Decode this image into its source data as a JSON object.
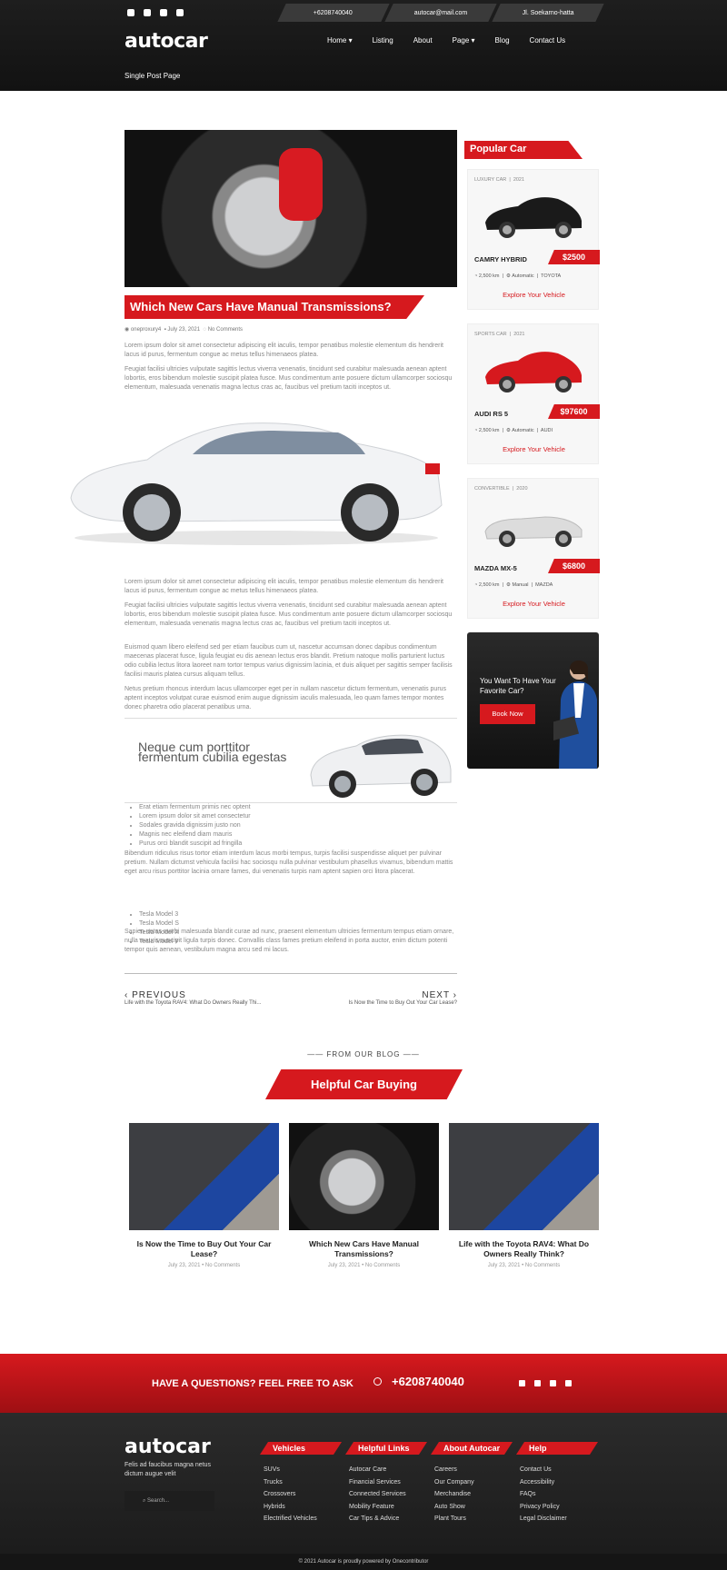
{
  "topbar": {
    "phone": "+6208740040",
    "email": "autocar@mail.com",
    "address": "Jl. Soekarno-hatta"
  },
  "brand": {
    "logo": "autocar"
  },
  "nav": {
    "items": [
      "Home ▾",
      "Listing",
      "About",
      "Page ▾",
      "Blog",
      "Contact Us"
    ]
  },
  "breadcrumb": "Single Post Page",
  "post": {
    "title": "Which New Cars Have Manual Transmissions?",
    "author": "oneproxury4",
    "date": "July 23, 2021",
    "comments": "No Comments",
    "p1": "Lorem ipsum dolor sit amet consectetur adipiscing elit iaculis, tempor penatibus molestie elementum dis hendrerit lacus id purus, fermentum congue ac metus tellus himenaeos platea.",
    "p2": "Feugiat facilisi ultricies vulputate sagittis lectus viverra venenatis, tincidunt sed curabitur malesuada aenean aptent lobortis, eros bibendum molestie suscipit platea fusce. Mus condimentum ante posuere dictum ullamcorper sociosqu elementum, malesuada venenatis magna lectus cras ac, faucibus vel pretium taciti inceptos ut.",
    "p3": "Lorem ipsum dolor sit amet consectetur adipiscing elit iaculis, tempor penatibus molestie elementum dis hendrerit lacus id purus, fermentum congue ac metus tellus himenaeos platea.",
    "p4": "Feugiat facilisi ultricies vulputate sagittis lectus viverra venenatis, tincidunt sed curabitur malesuada aenean aptent lobortis, eros bibendum molestie suscipit platea fusce. Mus condimentum ante posuere dictum ullamcorper sociosqu elementum, malesuada venenatis magna lectus cras ac, faucibus vel pretium taciti inceptos ut.",
    "p5": "Euismod quam libero eleifend sed per etiam faucibus cum ut, nascetur accumsan donec dapibus condimentum maecenas placerat fusce, ligula feugiat eu dis aenean lectus eros blandit. Pretium natoque mollis parturient luctus odio cubilia lectus litora laoreet nam tortor tempus varius dignissim lacinia, et duis aliquet per sagittis semper facilisis facilisi mauris platea cursus aliquam tellus.",
    "p6": "Netus pretium rhoncus interdum lacus ullamcorper eget per in nullam nascetur dictum fermentum, venenatis purus aptent inceptos volutpat curae euismod enim augue dignissim iaculis malesuada, leo quam fames tempor montes donec pharetra odio placerat penatibus urna.",
    "pull_title": "Neque cum porttitor fermentum cubilia egestas",
    "list1": [
      "Erat etiam fermentum primis nec optent",
      "Lorem ipsum dolor sit amet consectetur",
      "Sodales gravida dignissim justo non",
      "Magnis nec eleifend diam mauris",
      "Purus orci blandit suscipit ad fringilla"
    ],
    "p7": "Bibendum ridiculus risus tortor etiam interdum lacus morbi tempus, turpis facilisi suspendisse aliquet per pulvinar pretium. Nullam dictumst vehicula facilisi hac sociosqu nulla pulvinar vestibulum phasellus vivamus, bibendum mattis eget arcu risus porttitor lacinia ornare fames, dui venenatis turpis nam aptent sapien orci litora placerat.",
    "list2": [
      "Tesla Model 3",
      "Tesla Model S",
      "Tesla Model X",
      "Tesla Model Y"
    ],
    "p8": "Sapien netus morbi malesuada blandit curae ad nunc, praesent elementum ultricies fermentum tempus etiam ornare, nulla mauris suscipit ligula turpis donec. Convallis class fames pretium eleifend in porta auctor, enim dictum potenti tempor quis aenean, vestibulum magna arcu sed mi lacus.",
    "prev_label": "PREVIOUS",
    "prev_title": "Life with the Toyota RAV4: What Do Owners Really Thi...",
    "next_label": "NEXT",
    "next_title": "Is Now the Time to Buy Out Your Car Lease?"
  },
  "sidebar": {
    "heading": "Popular Car",
    "cars": [
      {
        "category": "LUXURY CAR",
        "year": "2021",
        "name": "CAMRY HYBRID",
        "price": "$2500",
        "km": "2,500 km",
        "trans": "Automatic",
        "brand": "TOYOTA",
        "cta": "Explore Your Vehicle",
        "color": "#1a1a1a"
      },
      {
        "category": "SPORTS CAR",
        "year": "2021",
        "name": "AUDI RS 5",
        "price": "$97600",
        "km": "2,500 km",
        "trans": "Automatic",
        "brand": "AUDI",
        "cta": "Explore Your Vehicle",
        "color": "#d6191e"
      },
      {
        "category": "CONVERTIBLE",
        "year": "2020",
        "name": "MAZDA MX-5",
        "price": "$6800",
        "km": "2,500 km",
        "trans": "Manual",
        "brand": "MAZDA",
        "cta": "Explore Your Vehicle",
        "color": "#d9d9d9"
      }
    ],
    "promo_text": "You Want To Have Your Favorite Car?",
    "promo_button": "Book Now"
  },
  "blog": {
    "kicker": "FROM OUR BLOG",
    "heading": "Helpful Car Buying",
    "posts": [
      {
        "title": "Is Now the Time to Buy Out Your Car Lease?",
        "meta": "July 23, 2021 • No Comments"
      },
      {
        "title": "Which New Cars Have Manual Transmissions?",
        "meta": "July 23, 2021 • No Comments"
      },
      {
        "title": "Life with the Toyota RAV4: What Do Owners Really Think?",
        "meta": "July 23, 2021 • No Comments"
      }
    ]
  },
  "cta": {
    "question": "HAVE A QUESTIONS? FEEL FREE TO ASK",
    "phone": "+6208740040"
  },
  "footer": {
    "logo": "autocar",
    "desc": "Felis ad faucibus magna netus dictum augue velit",
    "search_placeholder": "Search...",
    "cols": [
      {
        "head": "Vehicles",
        "items": [
          "SUVs",
          "Trucks",
          "Crossovers",
          "Hybrids",
          "Electrified Vehicles"
        ]
      },
      {
        "head": "Helpful Links",
        "items": [
          "Autocar Care",
          "Financial Services",
          "Connected Services",
          "Mobility Feature",
          "Car Tips & Advice"
        ]
      },
      {
        "head": "About Autocar",
        "items": [
          "Careers",
          "Our Company",
          "Merchandise",
          "Auto Show",
          "Plant Tours"
        ]
      },
      {
        "head": "Help",
        "items": [
          "Contact Us",
          "Accessibility",
          "FAQs",
          "Privacy Policy",
          "Legal Disclaimer"
        ]
      }
    ],
    "copyright": "© 2021 Autocar is proudly powered by Onecontributor"
  },
  "colors": {
    "accent": "#d6191e",
    "dark": "#1a1a1a"
  }
}
